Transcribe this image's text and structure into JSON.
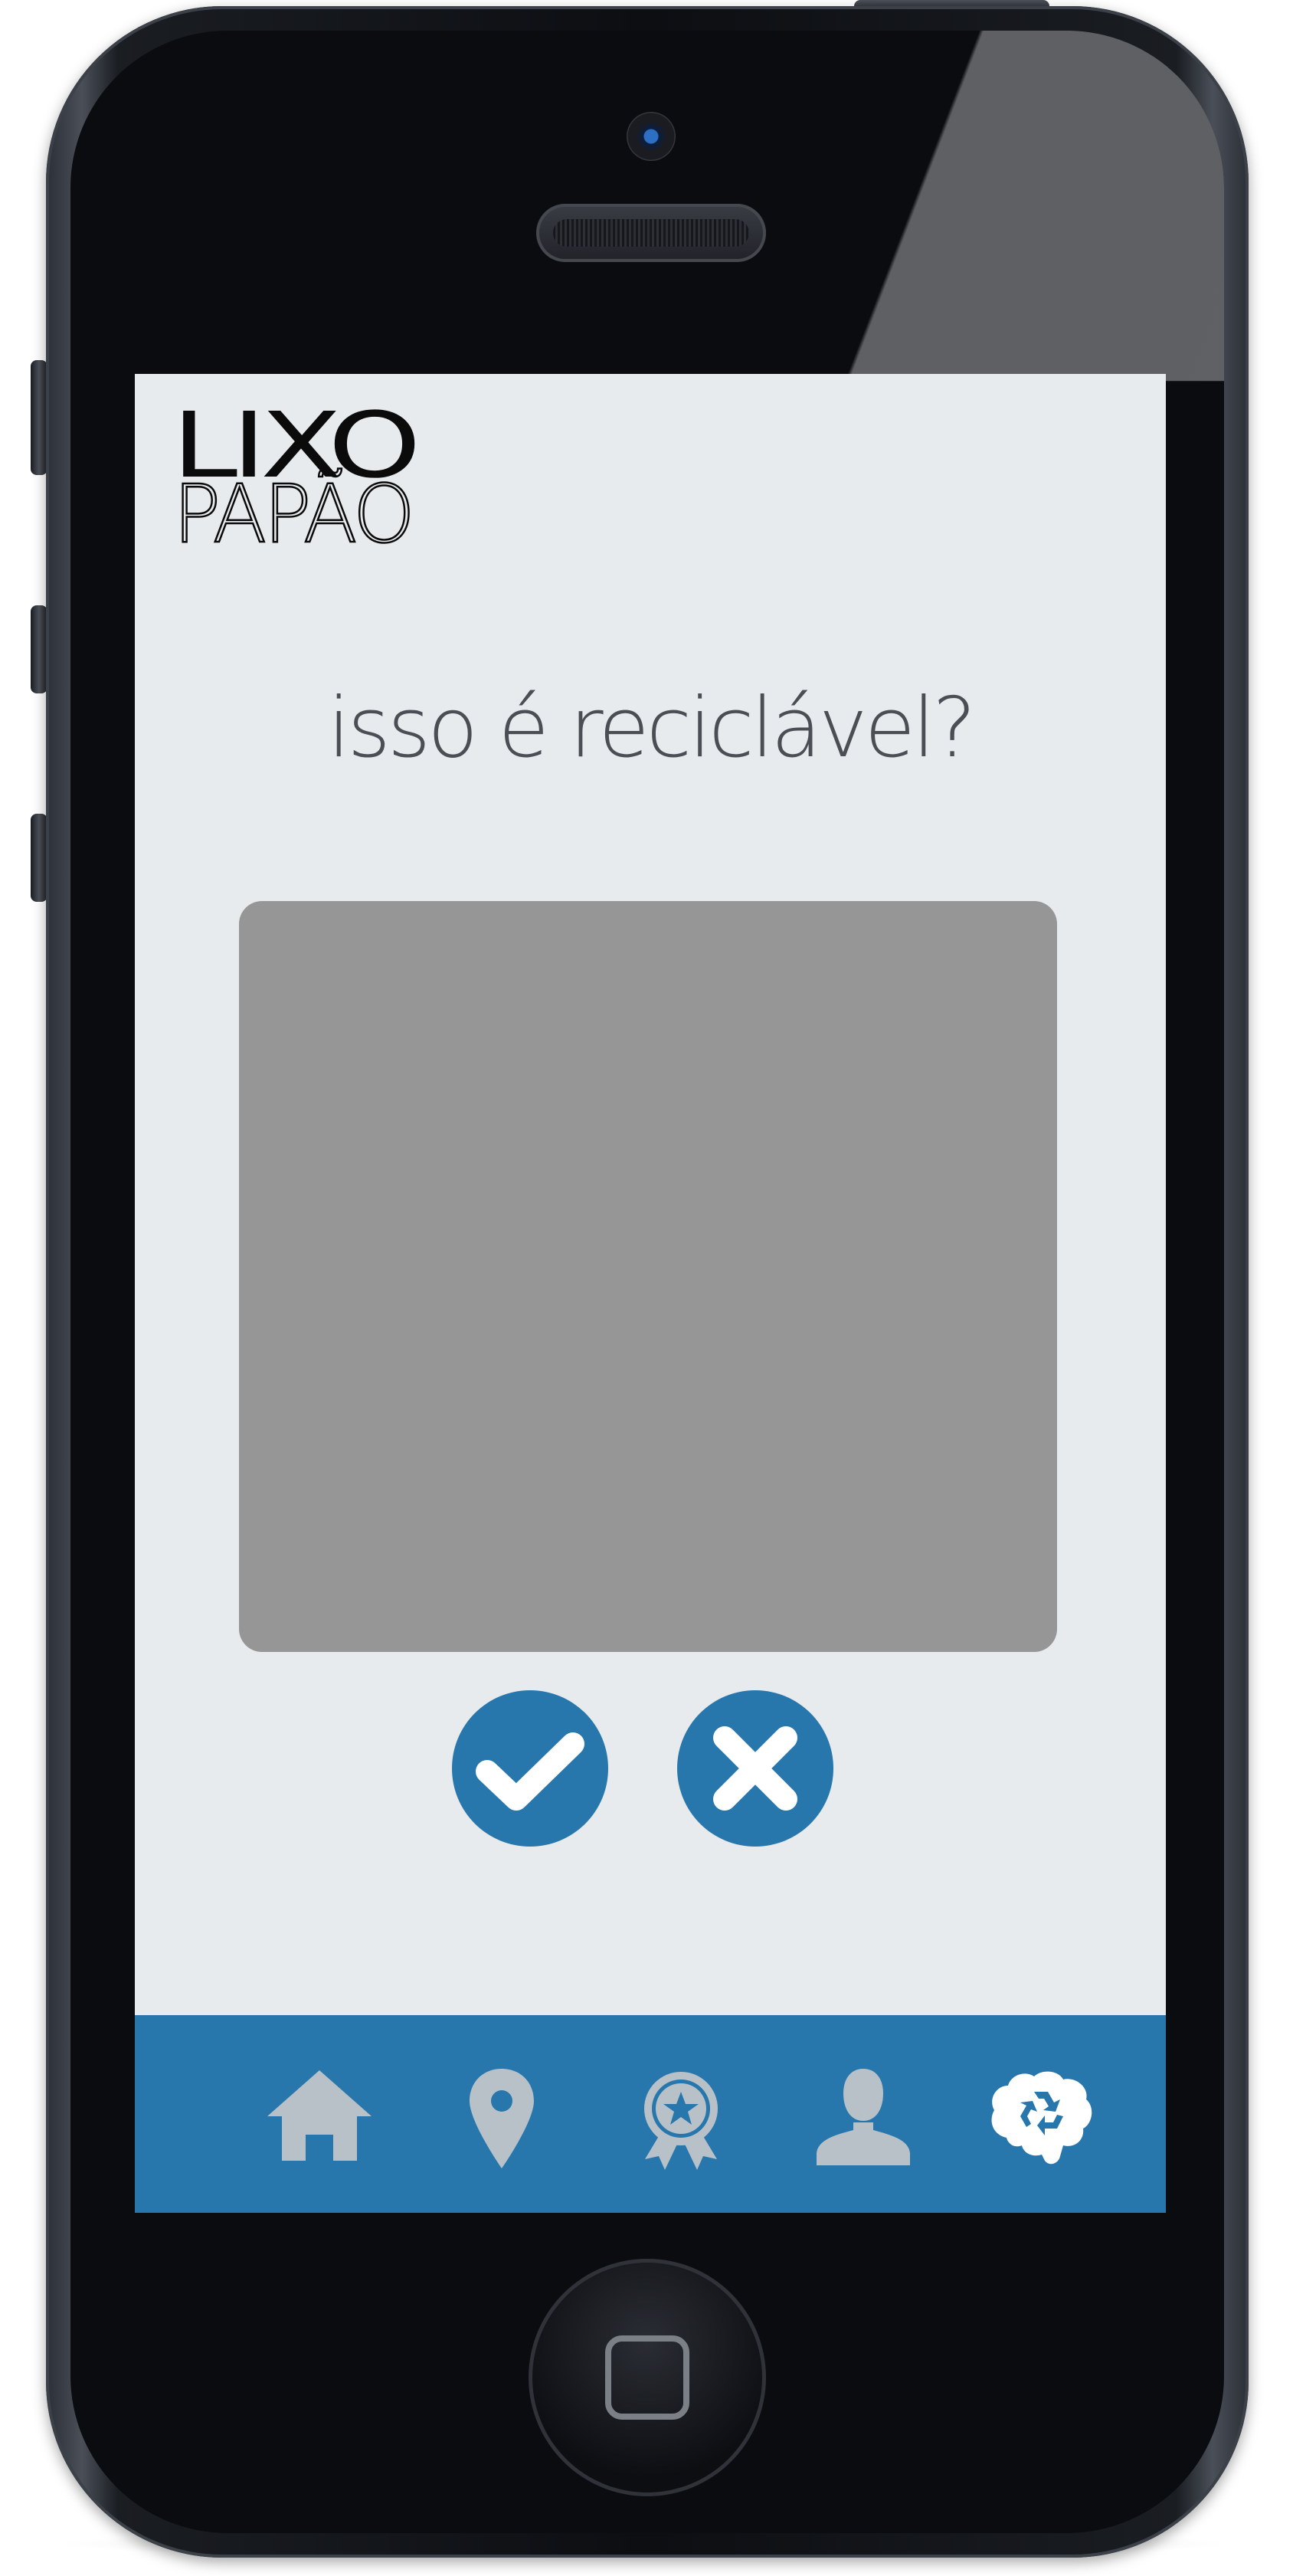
{
  "app": {
    "logo_line1": "LIXO",
    "logo_line2": "PAPÃO"
  },
  "main": {
    "question": "isso é reciclável?",
    "image_placeholder_color": "#969696"
  },
  "actions": {
    "confirm_icon": "check-icon",
    "reject_icon": "close-icon",
    "button_color": "#2777ad"
  },
  "tabbar": {
    "background_color": "#2777ad",
    "inactive_icon_color": "#b8c1c8",
    "active_tab": "recycle",
    "items": [
      {
        "id": "home",
        "icon": "home-icon"
      },
      {
        "id": "map",
        "icon": "map-pin-icon"
      },
      {
        "id": "achievements",
        "icon": "award-badge-icon"
      },
      {
        "id": "profile",
        "icon": "user-icon"
      },
      {
        "id": "recycle",
        "icon": "recycle-brain-icon"
      }
    ]
  }
}
